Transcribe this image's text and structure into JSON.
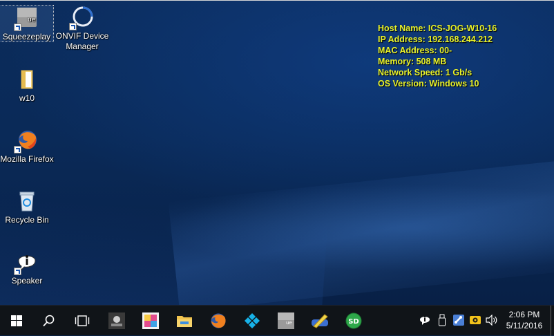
{
  "desktop": {
    "icons": [
      {
        "label": "Squeezeplay",
        "icon": "squeezeplay-icon"
      },
      {
        "label": "ONVIF Device Manager",
        "icon": "onvif-icon"
      },
      {
        "label": "w10",
        "icon": "folder-icon"
      },
      {
        "label": "Mozilla Firefox",
        "icon": "firefox-icon"
      },
      {
        "label": "Recycle Bin",
        "icon": "recycle-bin-icon"
      },
      {
        "label": "Speaker",
        "icon": "speaker-info-icon"
      }
    ]
  },
  "sysinfo": {
    "host": "Host Name: ICS-JOG-W10-16",
    "ip": "IP Address: 192.168.244.212",
    "mac": "MAC Address: 00-",
    "memory": "Memory: 508 MB",
    "network": "Network Speed: 1 Gb/s",
    "os": "OS Version: Windows 10"
  },
  "taskbar": {
    "pinned": [
      "start-icon",
      "search-icon",
      "task-view-icon",
      "squeezeplay-app-icon",
      "image-app-icon",
      "file-explorer-icon",
      "firefox-icon",
      "kodi-icon",
      "squeezeplay-alt-icon",
      "pencil-tool-icon",
      "sd-icon"
    ],
    "tray": [
      "info-tray-icon",
      "usb-tray-icon",
      "network-tool-tray-icon",
      "monitor-tray-icon",
      "volume-tray-icon"
    ],
    "clock": {
      "time": "2:06 PM",
      "date": "5/11/2016"
    }
  },
  "colors": {
    "sysinfo_text": "#e8f22a",
    "taskbar_bg": "#101418",
    "desktop_bg": "#0a2a58"
  }
}
